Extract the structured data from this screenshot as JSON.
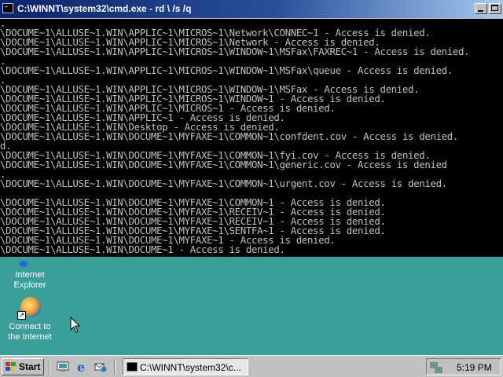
{
  "console_window": {
    "title": "C:\\WINNT\\system32\\cmd.exe - rd \\ /s /q",
    "lines": [
      ".",
      "\\DOCUME~1\\ALLUSE~1.WIN\\APPLIC~1\\MICROS~1\\Network\\CONNEC~1 - Access is denied.",
      "\\DOCUME~1\\ALLUSE~1.WIN\\APPLIC~1\\MICROS~1\\Network - Access is denied.",
      "\\DOCUME~1\\ALLUSE~1.WIN\\APPLIC~1\\MICROS~1\\WINDOW~1\\MSFax\\FAXREC~1 - Access is denied.",
      ".",
      "\\DOCUME~1\\ALLUSE~1.WIN\\APPLIC~1\\MICROS~1\\WINDOW~1\\MSFax\\queue - Access is denied.",
      ".",
      "\\DOCUME~1\\ALLUSE~1.WIN\\APPLIC~1\\MICROS~1\\WINDOW~1\\MSFax - Access is denied.",
      "\\DOCUME~1\\ALLUSE~1.WIN\\APPLIC~1\\MICROS~1\\WINDOW~1 - Access is denied.",
      "\\DOCUME~1\\ALLUSE~1.WIN\\APPLIC~1\\MICROS~1 - Access is denied.",
      "\\DOCUME~1\\ALLUSE~1.WIN\\APPLIC~1 - Access is denied.",
      "\\DOCUME~1\\ALLUSE~1.WIN\\Desktop - Access is denied.",
      "\\DOCUME~1\\ALLUSE~1.WIN\\DOCUME~1\\MYFAXE~1\\COMMON~1\\confdent.cov - Access is denied.",
      "d.",
      "\\DOCUME~1\\ALLUSE~1.WIN\\DOCUME~1\\MYFAXE~1\\COMMON~1\\fyi.cov - Access is denied.",
      "\\DOCUME~1\\ALLUSE~1.WIN\\DOCUME~1\\MYFAXE~1\\COMMON~1\\generic.cov - Access is denied",
      ".",
      "\\DOCUME~1\\ALLUSE~1.WIN\\DOCUME~1\\MYFAXE~1\\COMMON~1\\urgent.cov - Access is denied.",
      "",
      "\\DOCUME~1\\ALLUSE~1.WIN\\DOCUME~1\\MYFAXE~1\\COMMON~1 - Access is denied.",
      "\\DOCUME~1\\ALLUSE~1.WIN\\DOCUME~1\\MYFAXE~1\\RECEIV~1 - Access is denied.",
      "\\DOCUME~1\\ALLUSE~1.WIN\\DOCUME~1\\MYFAXE~1\\RECEIV~1 - Access is denied.",
      "\\DOCUME~1\\ALLUSE~1.WIN\\DOCUME~1\\MYFAXE~1\\SENTFA~1 - Access is denied.",
      "\\DOCUME~1\\ALLUSE~1.WIN\\DOCUME~1\\MYFAXE~1 - Access is denied.",
      "\\DOCUME~1\\ALLUSE~1.WIN\\DOCUME~1 - Access is denied."
    ]
  },
  "desktop": {
    "icons": [
      {
        "name": "Internet Explorer",
        "label_lines": [
          "Internet",
          "Explorer"
        ]
      },
      {
        "name": "Connect to the Internet",
        "label_lines": [
          "Connect to",
          "the Internet"
        ]
      }
    ]
  },
  "taskbar": {
    "start_label": "Start",
    "task_label": "C:\\WINNT\\system32\\c...",
    "clock": "5:19 PM"
  },
  "colors": {
    "desktop": "#3a9e9a",
    "console_bg": "#000000",
    "console_text": "#c0c0c0",
    "title_active": "#0a246a",
    "taskbar": "#c0c0c0"
  },
  "icons": [
    "console-icon",
    "minimize-icon",
    "maximize-icon",
    "internet-explorer-icon",
    "connect-to-internet-icon",
    "windows-flag-icon",
    "show-desktop-icon",
    "ie-quicklaunch-icon",
    "outlook-express-icon",
    "network-tray-icon",
    "mouse-pointer-icon"
  ]
}
